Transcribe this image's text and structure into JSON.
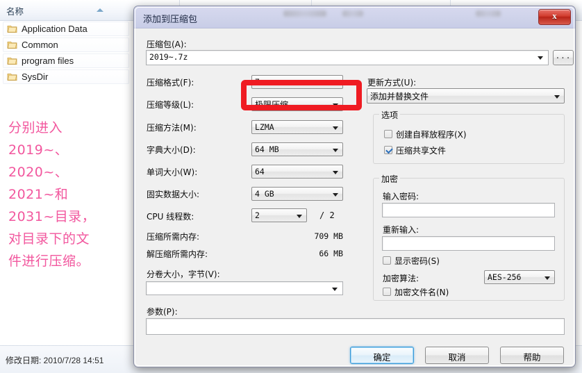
{
  "explorer": {
    "column_header": "名称",
    "items": [
      {
        "name": "Application Data",
        "icon": "folder-icon"
      },
      {
        "name": "Common",
        "icon": "folder-icon"
      },
      {
        "name": "program files",
        "icon": "folder-icon"
      },
      {
        "name": "SysDir",
        "icon": "folder-icon"
      }
    ],
    "annotation": "分别进入\n2019~、\n2020~、\n2021~和\n2031~目录，\n对目录下的文\n件进行压缩。",
    "annotation_color": "#f2579e",
    "status": "修改日期: 2010/7/28 14:51"
  },
  "dialog": {
    "title": "添加到压缩包",
    "close_label": "x",
    "archive": {
      "label": "压缩包(A):",
      "value": "2019~.7z",
      "browse_label": "..."
    },
    "left": {
      "format_label": "压缩格式(F):",
      "format_value": "7z",
      "level_label": "压缩等级(L):",
      "level_value": "极限压缩",
      "method_label": "压缩方法(M):",
      "method_value": "LZMA",
      "dict_label": "字典大小(D):",
      "dict_value": "64 MB",
      "word_label": "单词大小(W):",
      "word_value": "64",
      "solid_label": "固实数据大小:",
      "solid_value": "4 GB",
      "threads_label": "CPU 线程数:",
      "threads_value": "2",
      "threads_total": "/ 2",
      "mem_compress_label": "压缩所需内存:",
      "mem_compress_value": "709 MB",
      "mem_decompress_label": "解压缩所需内存:",
      "mem_decompress_value": "66 MB",
      "split_label": "分卷大小，字节(V):",
      "split_value": "",
      "params_label": "参数(P):",
      "params_value": ""
    },
    "right": {
      "update_label": "更新方式(U):",
      "update_value": "添加并替换文件",
      "options_group": "选项",
      "sfx_label": "创建自释放程序(X)",
      "sfx_checked": false,
      "shared_label": "压缩共享文件",
      "shared_checked": true,
      "encrypt_group": "加密",
      "password_label": "输入密码:",
      "password_value": "",
      "password2_label": "重新输入:",
      "password2_value": "",
      "show_password_label": "显示密码(S)",
      "show_password_checked": false,
      "algo_label": "加密算法:",
      "algo_value": "AES-256",
      "encrypt_names_label": "加密文件名(N)",
      "encrypt_names_checked": false
    },
    "buttons": {
      "ok": "确定",
      "cancel": "取消",
      "help": "帮助"
    }
  },
  "highlight": {
    "color": "#ef1b22",
    "target": "压缩等级"
  }
}
